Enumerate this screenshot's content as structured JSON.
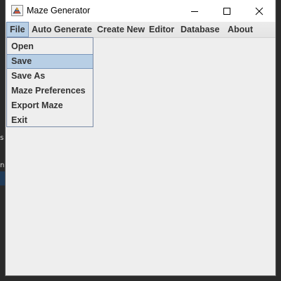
{
  "window": {
    "title": "Maze Generator"
  },
  "menubar": {
    "items": [
      {
        "label": "File"
      },
      {
        "label": "Auto Generate"
      },
      {
        "label": "Create New"
      },
      {
        "label": "Editor"
      },
      {
        "label": "Database"
      },
      {
        "label": "About"
      }
    ],
    "active_index": 0
  },
  "file_menu": {
    "items": [
      {
        "label": "Open"
      },
      {
        "label": "Save"
      },
      {
        "label": "Save As"
      },
      {
        "label": "Maze Preferences"
      },
      {
        "label": "Export Maze"
      },
      {
        "label": "Exit"
      }
    ],
    "selected_index": 1
  },
  "background": {
    "fragment_1": "s",
    "fragment_2": "n"
  },
  "icons": {
    "app": "java-app-icon",
    "minimize": "minimize-icon",
    "maximize": "maximize-icon",
    "close": "close-icon"
  },
  "colors": {
    "highlight": "#b8cfe5",
    "highlight_border": "#7a97bb",
    "menu_text": "#333333",
    "window_bg": "#eeeeee"
  }
}
